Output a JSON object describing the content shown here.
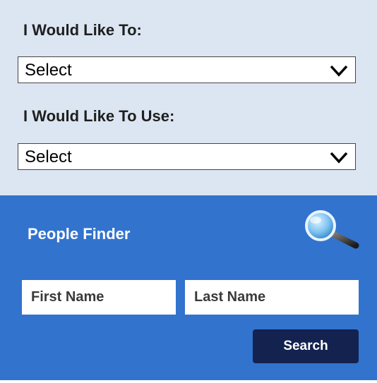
{
  "selector": {
    "label1": "I Would Like To:",
    "select1_value": "Select",
    "label2": "I Would Like To Use:",
    "select2_value": "Select"
  },
  "people_finder": {
    "title": "People Finder",
    "first_name_placeholder": "First Name",
    "last_name_placeholder": "Last Name",
    "search_label": "Search",
    "icon": "magnifier-icon"
  },
  "colors": {
    "top_background": "#dce6f2",
    "bottom_background": "#3273ce",
    "button_background": "#13224f"
  }
}
